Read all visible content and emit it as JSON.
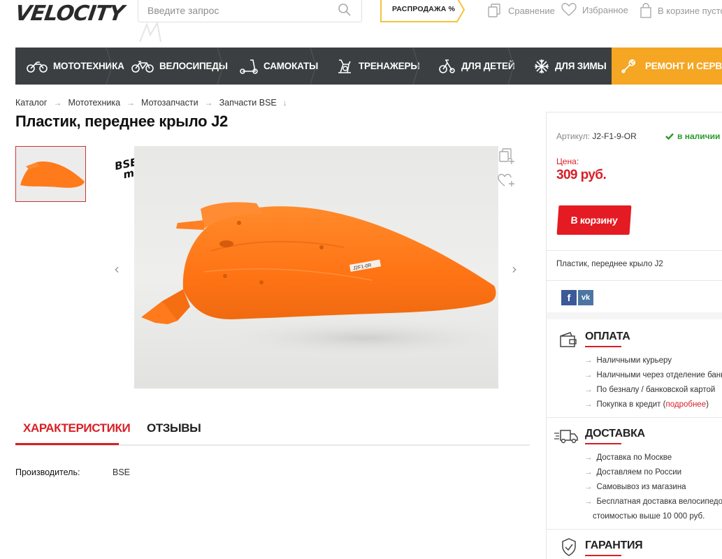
{
  "header": {
    "logo": "VELOCITY",
    "search_placeholder": "Введите запрос",
    "sale_label": "РАСПРОДАЖА %",
    "compare_label": "Сравнение",
    "favorites_label": "Избранное",
    "cart_label": "В корзине пусто"
  },
  "nav": {
    "items": [
      {
        "label": "МОТОТЕХНИКА",
        "icon": "motorcycle-icon"
      },
      {
        "label": "ВЕЛОСИПЕДЫ",
        "icon": "bicycle-icon"
      },
      {
        "label": "САМОКАТЫ",
        "icon": "scooter-icon"
      },
      {
        "label": "ТРЕНАЖЕРЫ",
        "icon": "exercise-bike-icon"
      },
      {
        "label": "ДЛЯ ДЕТЕЙ",
        "icon": "kids-bike-icon"
      },
      {
        "label": "ДЛЯ ЗИМЫ",
        "icon": "snowflake-icon"
      },
      {
        "label": "РЕМОНТ И СЕРВИС",
        "icon": "wrench-icon"
      }
    ]
  },
  "breadcrumb": {
    "items": [
      "Каталог",
      "Мототехника",
      "Мотозапчасти",
      "Запчасти BSE"
    ],
    "last_arrow": "↓"
  },
  "product": {
    "title": "Пластик, переднее крыло J2",
    "brand_badge_line1": "BSE",
    "brand_badge_line2": "moto",
    "part_label": "J2F1-0R"
  },
  "tabs": {
    "characteristics": "ХАРАКТЕРИСТИКИ",
    "reviews": "ОТЗЫВЫ"
  },
  "specs": {
    "manufacturer_label": "Производитель:",
    "manufacturer_value": "BSE"
  },
  "sidebar": {
    "sku_label": "Артикул:",
    "sku_value": "J2-F1-9-OR",
    "stock": "в наличии",
    "price_label": "Цена:",
    "price": "309 руб.",
    "cart_button": "В корзину",
    "description": "Пластик, переднее крыло J2",
    "payment": {
      "title": "ОПЛАТА",
      "items": [
        "Наличными курьеру",
        "Наличными через отделение банка",
        "По безналу / банковской картой"
      ],
      "credit_text": "Покупка в кредит (",
      "credit_link": "подробнее",
      "credit_close": ")"
    },
    "delivery": {
      "title": "ДОСТАВКА",
      "items": [
        "Доставка по Москве",
        "Доставляем по России",
        "Самовывоз из магазина",
        "Бесплатная доставка велосипедов"
      ],
      "last_line": "стоимостью выше 10 000 руб."
    },
    "warranty": {
      "title": "ГАРАНТИЯ"
    }
  },
  "colors": {
    "nav_bg": "#3b3f41",
    "accent_orange": "#f5a623",
    "brand_red": "#d81f26",
    "stock_green": "#2b9a2b",
    "product_orange": "#ff7a1a"
  }
}
